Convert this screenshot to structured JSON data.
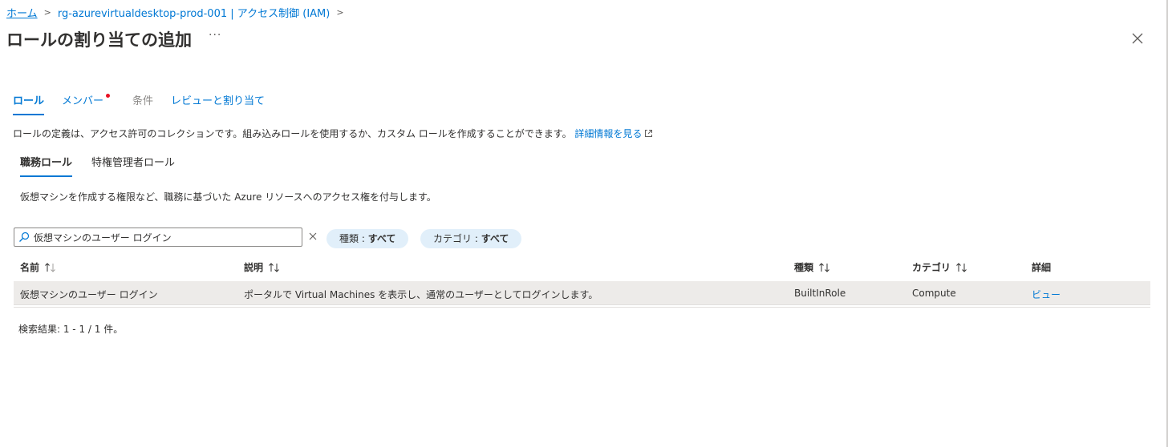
{
  "breadcrumb": {
    "items": [
      "ホーム",
      "rg-azurevirtualdesktop-prod-001 | アクセス制御 (IAM)"
    ]
  },
  "page": {
    "title": "ロールの割り当ての追加",
    "more": "···"
  },
  "tabs": [
    {
      "label": "ロール",
      "state": "active"
    },
    {
      "label": "メンバー",
      "state": "required"
    },
    {
      "label": "条件",
      "state": "disabled"
    },
    {
      "label": "レビューと割り当て",
      "state": "normal"
    }
  ],
  "description": {
    "text": "ロールの定義は、アクセス許可のコレクションです。組み込みロールを使用するか、カスタム ロールを作成することができます。",
    "link": "詳細情報を見る"
  },
  "subtabs": [
    {
      "label": "職務ロール",
      "active": true
    },
    {
      "label": "特権管理者ロール",
      "active": false
    }
  ],
  "subdescription": "仮想マシンを作成する権限など、職務に基づいた Azure リソースへのアクセス権を付与します。",
  "search": {
    "value": "仮想マシンのユーザー ログイン"
  },
  "filters": {
    "type": {
      "label": "種類 : ",
      "value": "すべて"
    },
    "category": {
      "label": "カテゴリ : ",
      "value": "すべて"
    }
  },
  "table": {
    "headers": {
      "name": "名前",
      "description": "説明",
      "type": "種類",
      "category": "カテゴリ",
      "details": "詳細"
    },
    "rows": [
      {
        "name": "仮想マシンのユーザー ログイン",
        "description": "ポータルで Virtual Machines を表示し、通常のユーザーとしてログインします。",
        "type": "BuiltInRole",
        "category": "Compute",
        "details": "ビュー"
      }
    ]
  },
  "result_text": "検索結果: 1 - 1 / 1 件。",
  "colors": {
    "accent": "#0078d4",
    "required_dot": "#e81123",
    "pill_bg": "#e1effa",
    "row_selected": "#edebe9"
  }
}
